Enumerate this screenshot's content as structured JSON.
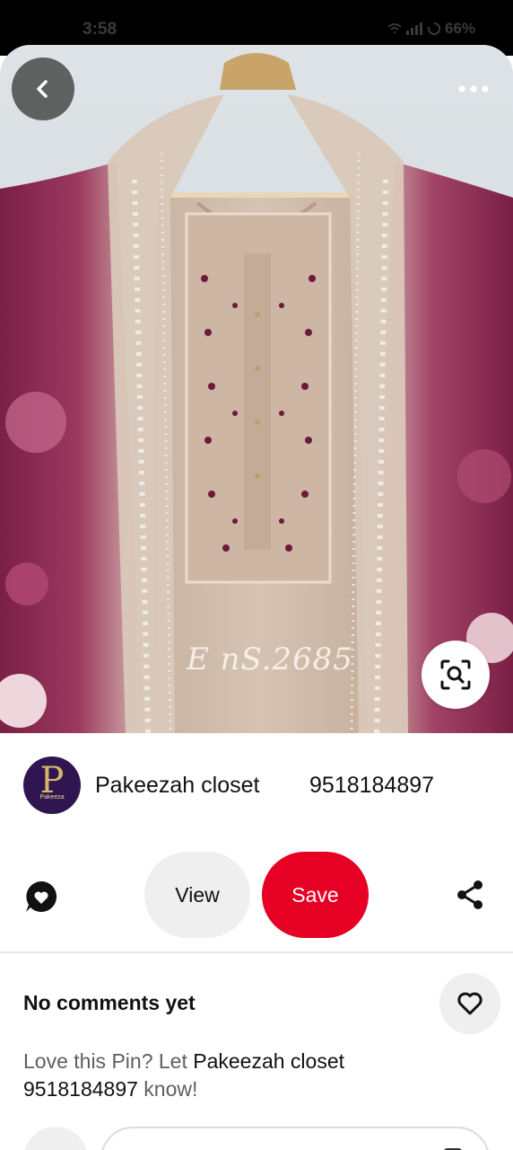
{
  "status_bar": {
    "time": "3:58",
    "battery": "66%"
  },
  "pin": {
    "watermark": "E nS.2685",
    "icons": {
      "back": "chevron-left-icon",
      "more": "more-horizontal-icon",
      "visual_search": "visual-search-icon"
    }
  },
  "creator": {
    "name": "Pakeezah closet        9518184897",
    "avatar_letter": "P",
    "avatar_word": "Pakeeza"
  },
  "actions": {
    "view_label": "View",
    "save_label": "Save"
  },
  "comments": {
    "title": "No comments yet",
    "prompt_prefix": "Love this Pin? Let ",
    "prompt_name": "Pakeezah closet 9518184897",
    "prompt_suffix": " know!"
  },
  "colors": {
    "save_red": "#e60023",
    "button_grey": "#efefef"
  }
}
